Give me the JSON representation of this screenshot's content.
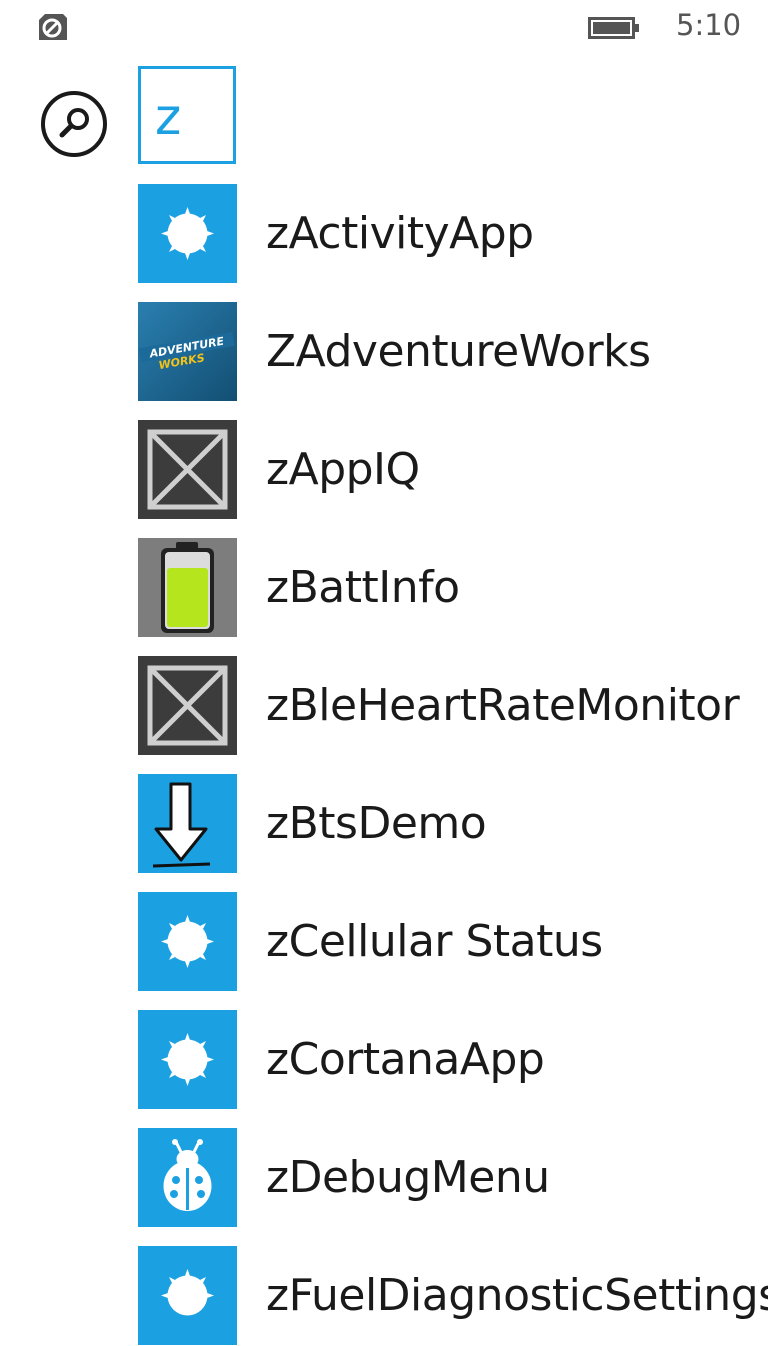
{
  "status_bar": {
    "time": "5:10",
    "left_icon": "location-tracking-icon",
    "battery_icon": "battery-icon"
  },
  "search": {
    "value": "z",
    "icon": "search-icon"
  },
  "colors": {
    "accent": "#1ba1e2",
    "placeholder_tile": "#3c3c3c",
    "battery_tile": "#7d7d7d",
    "battery_fill": "#b5e61d"
  },
  "apps": [
    {
      "name": "zActivityApp",
      "icon": "default-app-sun-icon"
    },
    {
      "name": "ZAdventureWorks",
      "icon": "adventure-works-logo",
      "logo_text_line1": "ADVENTURE",
      "logo_text_line2": "WORKS"
    },
    {
      "name": "zAppIQ",
      "icon": "placeholder-x-icon"
    },
    {
      "name": "zBattInfo",
      "icon": "battery-icon"
    },
    {
      "name": "zBleHeartRateMonitor",
      "icon": "placeholder-x-icon"
    },
    {
      "name": "zBtsDemo",
      "icon": "download-arrow-icon"
    },
    {
      "name": "zCellular Status",
      "icon": "default-app-sun-icon"
    },
    {
      "name": "zCortanaApp",
      "icon": "default-app-sun-icon"
    },
    {
      "name": "zDebugMenu",
      "icon": "ladybug-icon"
    },
    {
      "name": "zFuelDiagnosticSettings",
      "icon": "default-app-sun-icon"
    }
  ]
}
